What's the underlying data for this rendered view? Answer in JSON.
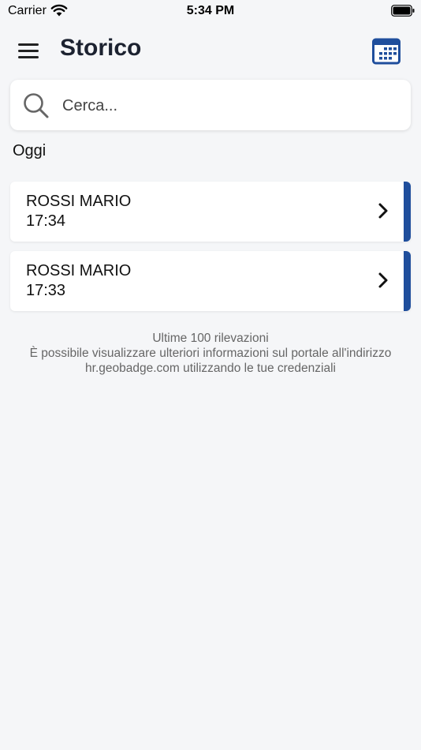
{
  "status_bar": {
    "carrier": "Carrier",
    "time": "5:34 PM"
  },
  "header": {
    "title": "Storico"
  },
  "search": {
    "placeholder": "Cerca..."
  },
  "section": {
    "label": "Oggi"
  },
  "entries": [
    {
      "name": "ROSSI MARIO",
      "time": "17:34"
    },
    {
      "name": "ROSSI MARIO",
      "time": "17:33"
    }
  ],
  "footer": {
    "line1": "Ultime 100 rilevazioni",
    "line2": "È possibile visualizzare ulteriori informazioni sul portale all'indirizzo",
    "line3": "hr.geobadge.com utilizzando le tue credenziali"
  },
  "icons": {
    "menu": "hamburger-icon",
    "calendar": "calendar-icon",
    "search": "search-icon",
    "chevron": "chevron-right-icon",
    "wifi": "wifi-icon",
    "battery": "battery-icon"
  },
  "colors": {
    "accent": "#1f4e9c",
    "background": "#f5f6f8",
    "title": "#1c2230"
  }
}
